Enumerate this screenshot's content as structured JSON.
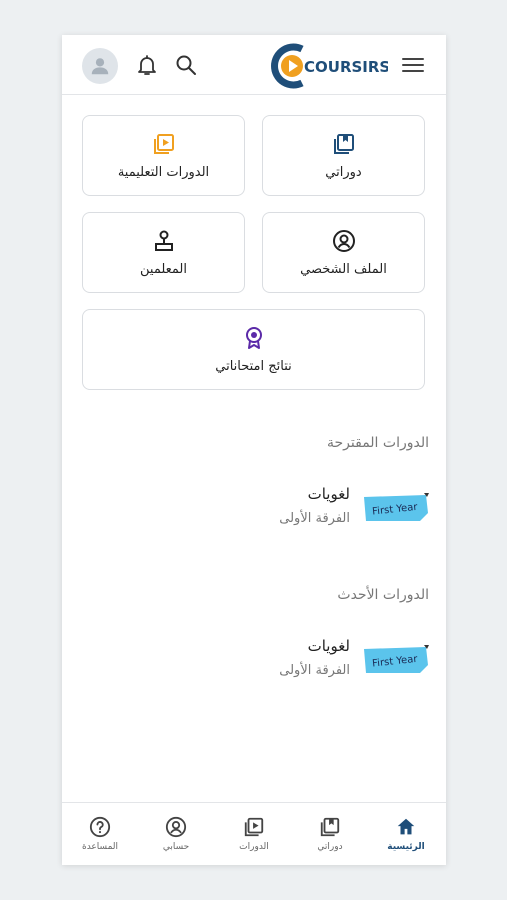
{
  "header": {
    "logo_text": "COURSIRS",
    "icons": [
      "avatar-icon",
      "bell-icon",
      "search-icon",
      "menu-icon"
    ]
  },
  "tiles": [
    {
      "label": "دوراتي",
      "icon": "bookmark-book-icon",
      "color": "#1f4e79"
    },
    {
      "label": "الدورات التعليمية",
      "icon": "play-library-icon",
      "color": "#f0a020"
    },
    {
      "label": "الملف الشخصي",
      "icon": "profile-circle-icon",
      "color": "#222222"
    },
    {
      "label": "المعلمين",
      "icon": "teacher-icon",
      "color": "#222222"
    },
    {
      "label": "نتائج امتحاناتي",
      "icon": "award-badge-icon",
      "color": "#5b2aa8"
    }
  ],
  "suggested": {
    "title": "الدورات المقترحة",
    "items": [
      {
        "name": "لغويات",
        "subtitle": "الفرقة الأولى",
        "thumb_text": "First Year"
      }
    ]
  },
  "latest": {
    "title": "الدورات الأحدث",
    "items": [
      {
        "name": "لغويات",
        "subtitle": "الفرقة الأولى",
        "thumb_text": "First Year"
      }
    ]
  },
  "bottom_nav": [
    {
      "label": "الرئيسية",
      "icon": "home-icon",
      "active": true
    },
    {
      "label": "دوراتي",
      "icon": "bookmark-book-icon",
      "active": false
    },
    {
      "label": "الدورات",
      "icon": "play-library-icon",
      "active": false
    },
    {
      "label": "حسابي",
      "icon": "profile-circle-icon",
      "active": false
    },
    {
      "label": "المساعدة",
      "icon": "help-icon",
      "active": false
    }
  ],
  "colors": {
    "brand": "#1f4e79",
    "accent": "#f0a020",
    "active_nav": "#1f4e79",
    "thumb": "#5bc4ec"
  }
}
